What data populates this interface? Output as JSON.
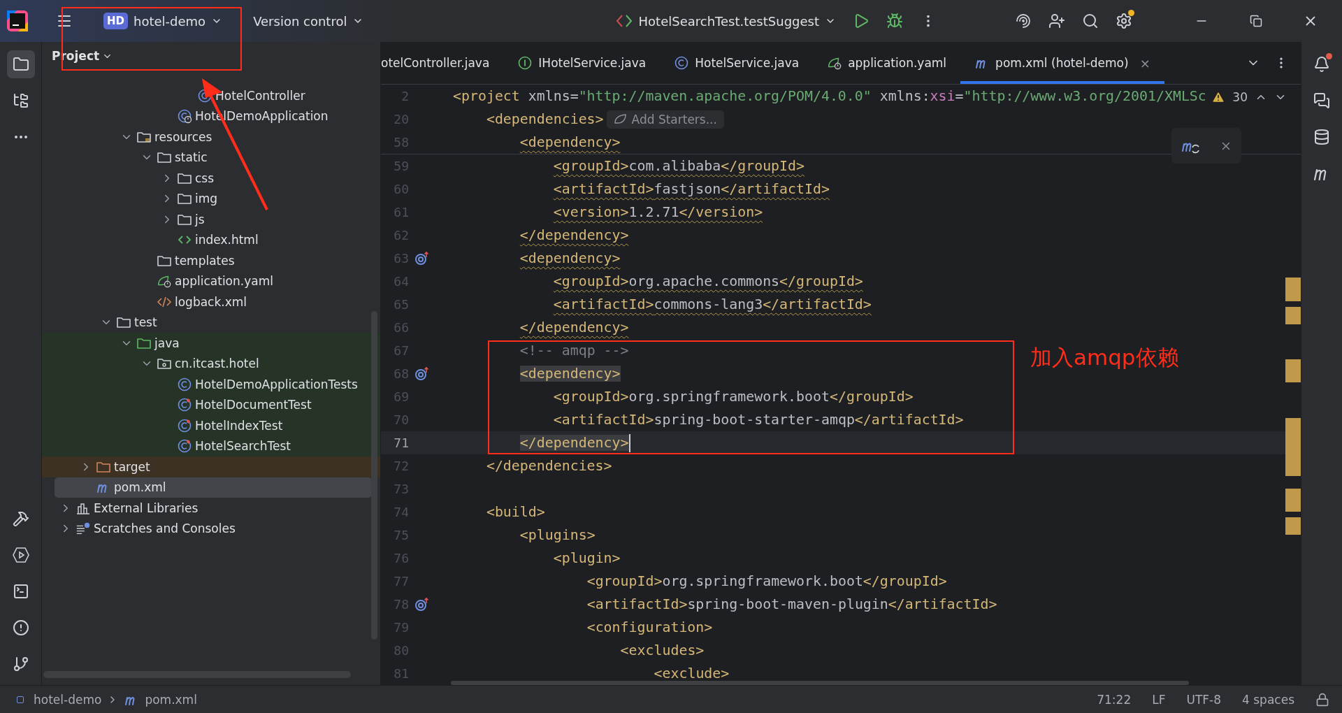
{
  "top_bar": {
    "project_badge": "HD",
    "project": "hotel-demo",
    "vcs": "Version control",
    "run_config": "HotelSearchTest.testSuggest"
  },
  "project_panel": {
    "title": "Project"
  },
  "tree": [
    {
      "children": [
        {
          "children": [
            {
              "children": [
                {
                  "children": [
                    {
                      "children": [
                        {
                          "children": [
                            {
                              "label": "HotelController",
                              "kind": "class",
                              "selected": false
                            }
                          ]
                        },
                        {
                          "label": "HotelDemoApplication",
                          "kind": "spring_class",
                          "selected": false
                        }
                      ]
                    }
                  ]
                },
                {
                  "label": "resources",
                  "kind": "resources_folder",
                  "expanded": true,
                  "selected": false,
                  "children": [
                    {
                      "label": "static",
                      "kind": "folder",
                      "expanded": true,
                      "selected": false,
                      "children": [
                        {
                          "label": "css",
                          "kind": "folder",
                          "expanded": false,
                          "selected": false
                        },
                        {
                          "label": "img",
                          "kind": "folder",
                          "expanded": false,
                          "selected": false
                        },
                        {
                          "label": "js",
                          "kind": "folder",
                          "expanded": false,
                          "selected": false
                        },
                        {
                          "label": "index.html",
                          "kind": "html",
                          "selected": false
                        }
                      ]
                    },
                    {
                      "label": "templates",
                      "kind": "folder",
                      "selected": false
                    },
                    {
                      "label": "application.yaml",
                      "kind": "yaml",
                      "selected": false
                    },
                    {
                      "label": "logback.xml",
                      "kind": "xml",
                      "selected": false
                    }
                  ]
                }
              ]
            },
            {
              "label": "test",
              "kind": "folder",
              "expanded": true,
              "selected": false,
              "children": [
                {
                  "label": "java",
                  "kind": "test_folder",
                  "test_sources": true,
                  "expanded": true,
                  "selected": false,
                  "children": [
                    {
                      "label": "cn.itcast.hotel",
                      "kind": "package",
                      "expanded": true,
                      "selected": false,
                      "children": [
                        {
                          "label": "HotelDemoApplicationTests",
                          "kind": "class",
                          "selected": false
                        },
                        {
                          "label": "HotelDocumentTest",
                          "kind": "test_class",
                          "selected": false
                        },
                        {
                          "label": "HotelIndexTest",
                          "kind": "test_class",
                          "selected": false
                        },
                        {
                          "label": "HotelSearchTest",
                          "kind": "test_class",
                          "selected": false
                        }
                      ]
                    }
                  ]
                }
              ]
            }
          ]
        },
        {
          "label": "target",
          "kind": "excluded_folder",
          "excluded": true,
          "expanded": false,
          "selected": false
        },
        {
          "label": "pom.xml",
          "kind": "maven",
          "selected": true
        }
      ]
    },
    {
      "label": "External Libraries",
      "kind": "library",
      "expanded": false,
      "selected": false
    },
    {
      "label": "Scratches and Consoles",
      "kind": "scratches",
      "expanded": false,
      "selected": false
    }
  ],
  "tabs": [
    {
      "label": "otelController.java",
      "selected": false
    },
    {
      "label": "IHotelService.java",
      "kind": "interface",
      "selected": false
    },
    {
      "label": "HotelService.java",
      "kind": "class",
      "selected": false
    },
    {
      "label": "application.yaml",
      "kind": "yaml",
      "selected": false
    },
    {
      "label": "pom.xml (hotel-demo)",
      "kind": "maven",
      "selected": true,
      "close": "×"
    }
  ],
  "editor": {
    "warnings": "30",
    "lines": [
      {
        "number": "2",
        "tokens": [
          {
            "kind": "tag",
            "text": "<project"
          },
          {
            "kind": "text",
            "text": " xmlns="
          },
          {
            "kind": "string",
            "text": "\"http://maven.apache.org/POM/4.0.0\""
          },
          {
            "kind": "text",
            "text": " xmlns:"
          },
          {
            "kind": "attr",
            "text": "xsi"
          },
          {
            "kind": "text",
            "text": "="
          },
          {
            "kind": "string",
            "text": "\"http://www.w3.org/2001/XMLSc"
          }
        ]
      },
      {
        "number": "20",
        "chip": "Add Starters...",
        "tokens": [
          {
            "kind": "tag",
            "text": "<dependencies>"
          }
        ]
      },
      {
        "number": "58",
        "warning": true,
        "tokens": [
          {
            "kind": "tag",
            "text": "<dependency>"
          }
        ]
      },
      {
        "number": "59",
        "warning": true,
        "tokens": [
          {
            "kind": "tag",
            "text": "<groupId>"
          },
          {
            "kind": "text",
            "text": "com.alibaba"
          },
          {
            "kind": "tag",
            "text": "</groupId>"
          }
        ]
      },
      {
        "number": "60",
        "warning": true,
        "tokens": [
          {
            "kind": "tag",
            "text": "<artifactId>"
          },
          {
            "kind": "text",
            "text": "fastjson"
          },
          {
            "kind": "tag",
            "text": "</artifactId>"
          }
        ]
      },
      {
        "number": "61",
        "warning": true,
        "tokens": [
          {
            "kind": "tag",
            "text": "<version>"
          },
          {
            "kind": "text",
            "text": "1.2.71"
          },
          {
            "kind": "tag",
            "text": "</version>"
          }
        ]
      },
      {
        "number": "62",
        "warning": true,
        "tokens": [
          {
            "kind": "tag",
            "text": "</dependency>"
          }
        ]
      },
      {
        "number": "63",
        "gutter_icon": true,
        "warning": true,
        "tokens": [
          {
            "kind": "tag",
            "text": "<dependency>"
          }
        ]
      },
      {
        "number": "64",
        "warning": true,
        "tokens": [
          {
            "kind": "tag",
            "text": "<groupId>"
          },
          {
            "kind": "text",
            "text": "org.apache.commons"
          },
          {
            "kind": "tag",
            "text": "</groupId>"
          }
        ]
      },
      {
        "number": "65",
        "warning": true,
        "tokens": [
          {
            "kind": "tag",
            "text": "<artifactId>"
          },
          {
            "kind": "text",
            "text": "commons-lang3"
          },
          {
            "kind": "tag",
            "text": "</artifactId>"
          }
        ]
      },
      {
        "number": "66",
        "warning": true,
        "tokens": [
          {
            "kind": "tag",
            "text": "</dependency>"
          }
        ]
      },
      {
        "number": "67",
        "tokens": [
          {
            "kind": "comment",
            "text": "<!-- amqp -->"
          }
        ]
      },
      {
        "number": "68",
        "gutter_icon": true,
        "tokens": [
          {
            "kind": "tag",
            "text": "<dependency>",
            "matched": true
          }
        ]
      },
      {
        "number": "69",
        "tokens": [
          {
            "kind": "tag",
            "text": "<groupId>"
          },
          {
            "kind": "text",
            "text": "org.springframework.boot"
          },
          {
            "kind": "tag",
            "text": "</groupId>"
          }
        ]
      },
      {
        "number": "70",
        "tokens": [
          {
            "kind": "tag",
            "text": "<artifactId>"
          },
          {
            "kind": "text",
            "text": "spring-boot-starter-amqp"
          },
          {
            "kind": "tag",
            "text": "</artifactId>"
          }
        ]
      },
      {
        "number": "71",
        "current": true,
        "tokens": [
          {
            "kind": "tag",
            "text": "</dependency>",
            "matched": true
          }
        ]
      },
      {
        "number": "72",
        "tokens": [
          {
            "kind": "tag",
            "text": "</dependencies>"
          }
        ]
      },
      {
        "number": "73"
      },
      {
        "number": "74",
        "tokens": [
          {
            "kind": "tag",
            "text": "<build>"
          }
        ]
      },
      {
        "number": "75",
        "tokens": [
          {
            "kind": "tag",
            "text": "<plugins>"
          }
        ]
      },
      {
        "number": "76",
        "tokens": [
          {
            "kind": "tag",
            "text": "<plugin>"
          }
        ]
      },
      {
        "number": "77",
        "tokens": [
          {
            "kind": "tag",
            "text": "<groupId>"
          },
          {
            "kind": "text",
            "text": "org.springframework.boot"
          },
          {
            "kind": "tag",
            "text": "</groupId>"
          }
        ]
      },
      {
        "number": "78",
        "gutter_icon": true,
        "tokens": [
          {
            "kind": "tag",
            "text": "<artifactId>"
          },
          {
            "kind": "text",
            "text": "spring-boot-maven-plugin"
          },
          {
            "kind": "tag",
            "text": "</artifactId>"
          }
        ]
      },
      {
        "number": "79",
        "tokens": [
          {
            "kind": "tag",
            "text": "<configuration>"
          }
        ]
      },
      {
        "number": "80",
        "tokens": [
          {
            "kind": "tag",
            "text": "<excludes>"
          }
        ]
      },
      {
        "number": "81",
        "tokens": [
          {
            "kind": "tag",
            "text": "<exclude>"
          }
        ]
      }
    ]
  },
  "annotation": {
    "note": "加入amqp依赖"
  },
  "status_bar": {
    "breadcrumbs": [
      {
        "label": "hotel-demo",
        "kind": "module"
      },
      {
        "label": "pom.xml",
        "kind": "maven"
      }
    ],
    "position": "71:22",
    "line_separator": "LF",
    "encoding": "UTF-8",
    "indent": "4 spaces"
  }
}
